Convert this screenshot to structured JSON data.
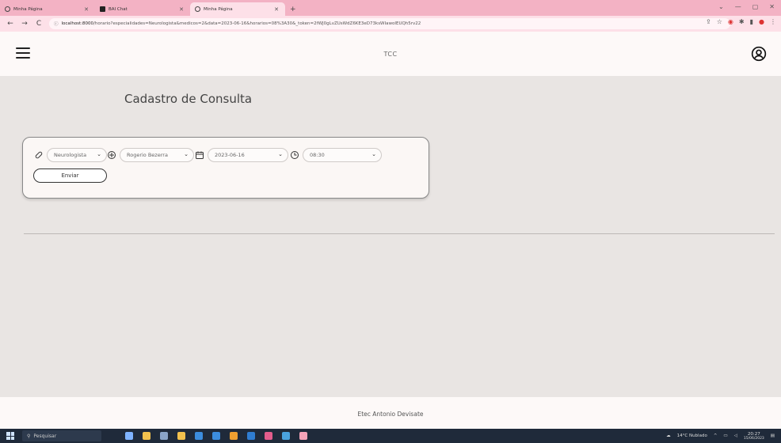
{
  "browser": {
    "tabs": [
      {
        "label": "Minha Página",
        "active": false
      },
      {
        "label": "BAI Chat",
        "active": false
      },
      {
        "label": "Minha Página",
        "active": true
      }
    ],
    "new_tab": "+",
    "url_host": "localhost:8000",
    "url_path": "/horario?especialidades=Neurologista&medicos=2&data=2023-06-16&horarios=08%3A30&_token=2fWJ0gLvZUsWdZ6KE3eD73ksWIawoIEUQh5rv22"
  },
  "header": {
    "brand": "TCC",
    "menu_icon": "hamburger-icon",
    "user_icon": "user-circle-icon"
  },
  "main": {
    "title": "Cadastro de Consulta",
    "form": {
      "especialidade": {
        "value": "Neurologista",
        "icon": "pill-icon"
      },
      "medico": {
        "value": "Rogerio Bezerra",
        "icon": "stethoscope-icon"
      },
      "data": {
        "value": "2023-06-16",
        "icon": "calendar-icon"
      },
      "horario": {
        "value": "08:30",
        "icon": "clock-icon"
      },
      "submit_label": "Enviar"
    }
  },
  "footer": {
    "text": "Etec Antonio Devisate"
  },
  "taskbar": {
    "search_placeholder": "Pesquisar",
    "weather": "14°C Nublado",
    "time": "20:27",
    "date": "15/06/2023"
  }
}
